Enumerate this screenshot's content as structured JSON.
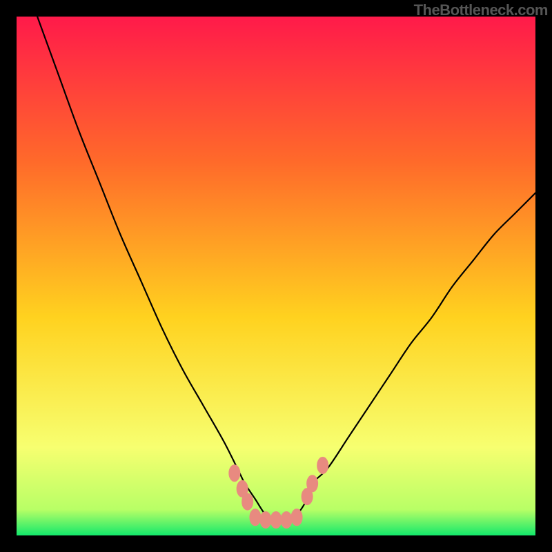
{
  "watermark": "TheBottleneck.com",
  "colors": {
    "bg": "#000000",
    "grad_top": "#ff1a4a",
    "grad_mid1": "#ff6a2a",
    "grad_mid2": "#ffd21f",
    "grad_low": "#f7ff70",
    "grad_bottom": "#13e86b",
    "curve": "#000000",
    "marker_fill": "#e88a80",
    "marker_stroke": "#e88a80"
  },
  "chart_data": {
    "type": "line",
    "title": "",
    "xlabel": "",
    "ylabel": "",
    "xlim": [
      0,
      100
    ],
    "ylim": [
      0,
      100
    ],
    "notes": "V-shaped bottleneck curve with flat minimum; markers sit near/at the valley floor. Axes and ticks are not rendered; values below are normalized 0–100 estimates read from pixel positions.",
    "series": [
      {
        "name": "bottleneck-curve",
        "x": [
          4,
          8,
          12,
          16,
          20,
          24,
          28,
          32,
          36,
          40,
          43,
          44,
          46,
          48,
          50,
          52,
          54,
          56,
          57,
          60,
          64,
          68,
          72,
          76,
          80,
          84,
          88,
          92,
          96,
          100
        ],
        "y": [
          100,
          89,
          78,
          68,
          58,
          49,
          40,
          32,
          25,
          18,
          12,
          10,
          7,
          4,
          3,
          3,
          4,
          7,
          10,
          13,
          19,
          25,
          31,
          37,
          42,
          48,
          53,
          58,
          62,
          66
        ]
      }
    ],
    "markers": [
      {
        "x": 42.0,
        "y": 12.0
      },
      {
        "x": 43.5,
        "y": 9.0
      },
      {
        "x": 44.5,
        "y": 6.5
      },
      {
        "x": 46.0,
        "y": 3.5
      },
      {
        "x": 48.0,
        "y": 3.0
      },
      {
        "x": 50.0,
        "y": 3.0
      },
      {
        "x": 52.0,
        "y": 3.0
      },
      {
        "x": 54.0,
        "y": 3.5
      },
      {
        "x": 56.0,
        "y": 7.5
      },
      {
        "x": 57.0,
        "y": 10.0
      },
      {
        "x": 59.0,
        "y": 13.5
      }
    ]
  }
}
